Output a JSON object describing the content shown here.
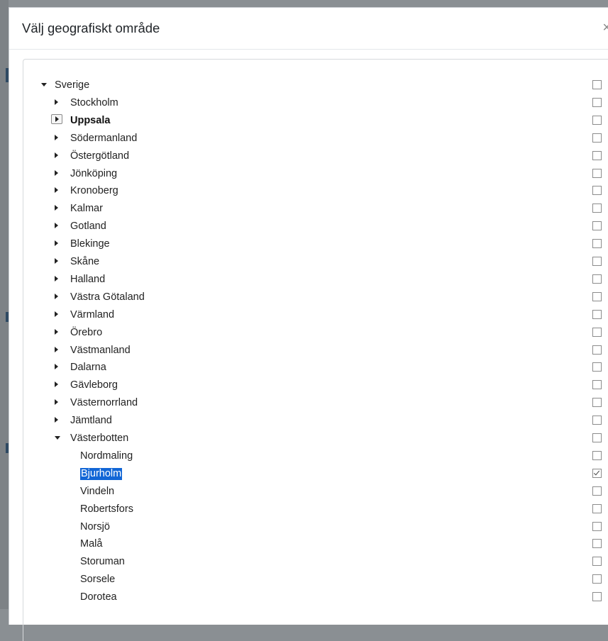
{
  "dialog": {
    "title": "Välj geografiskt område",
    "close_label": "×"
  },
  "tree": {
    "root": {
      "label": "Sverige",
      "expanded": true,
      "checked": false
    },
    "counties": [
      {
        "label": "Stockholm",
        "expanded": false,
        "checked": false
      },
      {
        "label": "Uppsala",
        "expanded": false,
        "checked": false,
        "focused": true
      },
      {
        "label": "Södermanland",
        "expanded": false,
        "checked": false
      },
      {
        "label": "Östergötland",
        "expanded": false,
        "checked": false
      },
      {
        "label": "Jönköping",
        "expanded": false,
        "checked": false
      },
      {
        "label": "Kronoberg",
        "expanded": false,
        "checked": false
      },
      {
        "label": "Kalmar",
        "expanded": false,
        "checked": false
      },
      {
        "label": "Gotland",
        "expanded": false,
        "checked": false
      },
      {
        "label": "Blekinge",
        "expanded": false,
        "checked": false
      },
      {
        "label": "Skåne",
        "expanded": false,
        "checked": false
      },
      {
        "label": "Halland",
        "expanded": false,
        "checked": false
      },
      {
        "label": "Västra Götaland",
        "expanded": false,
        "checked": false
      },
      {
        "label": "Värmland",
        "expanded": false,
        "checked": false
      },
      {
        "label": "Örebro",
        "expanded": false,
        "checked": false
      },
      {
        "label": "Västmanland",
        "expanded": false,
        "checked": false
      },
      {
        "label": "Dalarna",
        "expanded": false,
        "checked": false
      },
      {
        "label": "Gävleborg",
        "expanded": false,
        "checked": false
      },
      {
        "label": "Västernorrland",
        "expanded": false,
        "checked": false
      },
      {
        "label": "Jämtland",
        "expanded": false,
        "checked": false
      },
      {
        "label": "Västerbotten",
        "expanded": true,
        "checked": false
      }
    ],
    "municipalities": [
      {
        "label": "Nordmaling",
        "checked": false
      },
      {
        "label": "Bjurholm",
        "checked": true,
        "selected": true
      },
      {
        "label": "Vindeln",
        "checked": false
      },
      {
        "label": "Robertsfors",
        "checked": false
      },
      {
        "label": "Norsjö",
        "checked": false
      },
      {
        "label": "Malå",
        "checked": false
      },
      {
        "label": "Storuman",
        "checked": false
      },
      {
        "label": "Sorsele",
        "checked": false
      },
      {
        "label": "Dorotea",
        "checked": false
      }
    ]
  },
  "colors": {
    "selection": "#1266d6",
    "backdrop": "#8a8f93"
  }
}
